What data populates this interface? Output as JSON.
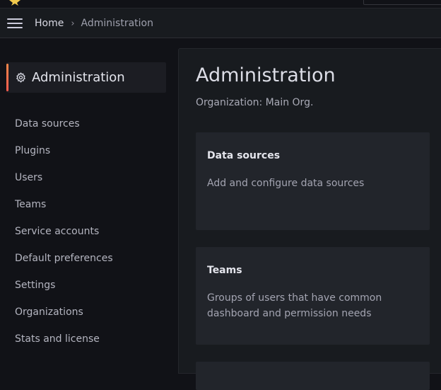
{
  "breadcrumb": {
    "home": "Home",
    "separator": "›",
    "current": "Administration"
  },
  "sidebar": {
    "section_title": "Administration",
    "section_icon": "gear-icon",
    "accent_colors": [
      "#f4874a",
      "#ff5b4e"
    ],
    "items": [
      {
        "label": "Data sources"
      },
      {
        "label": "Plugins"
      },
      {
        "label": "Users"
      },
      {
        "label": "Teams"
      },
      {
        "label": "Service accounts"
      },
      {
        "label": "Default preferences"
      },
      {
        "label": "Settings"
      },
      {
        "label": "Organizations"
      },
      {
        "label": "Stats and license"
      }
    ]
  },
  "main": {
    "title": "Administration",
    "subtitle": "Organization: Main Org.",
    "cards": [
      {
        "title": "Data sources",
        "description": "Add and configure data sources"
      },
      {
        "title": "Teams",
        "description": "Groups of users that have common dashboard and permission needs"
      }
    ]
  },
  "icons": {
    "menu": "hamburger-menu-icon",
    "star": "star-icon"
  }
}
